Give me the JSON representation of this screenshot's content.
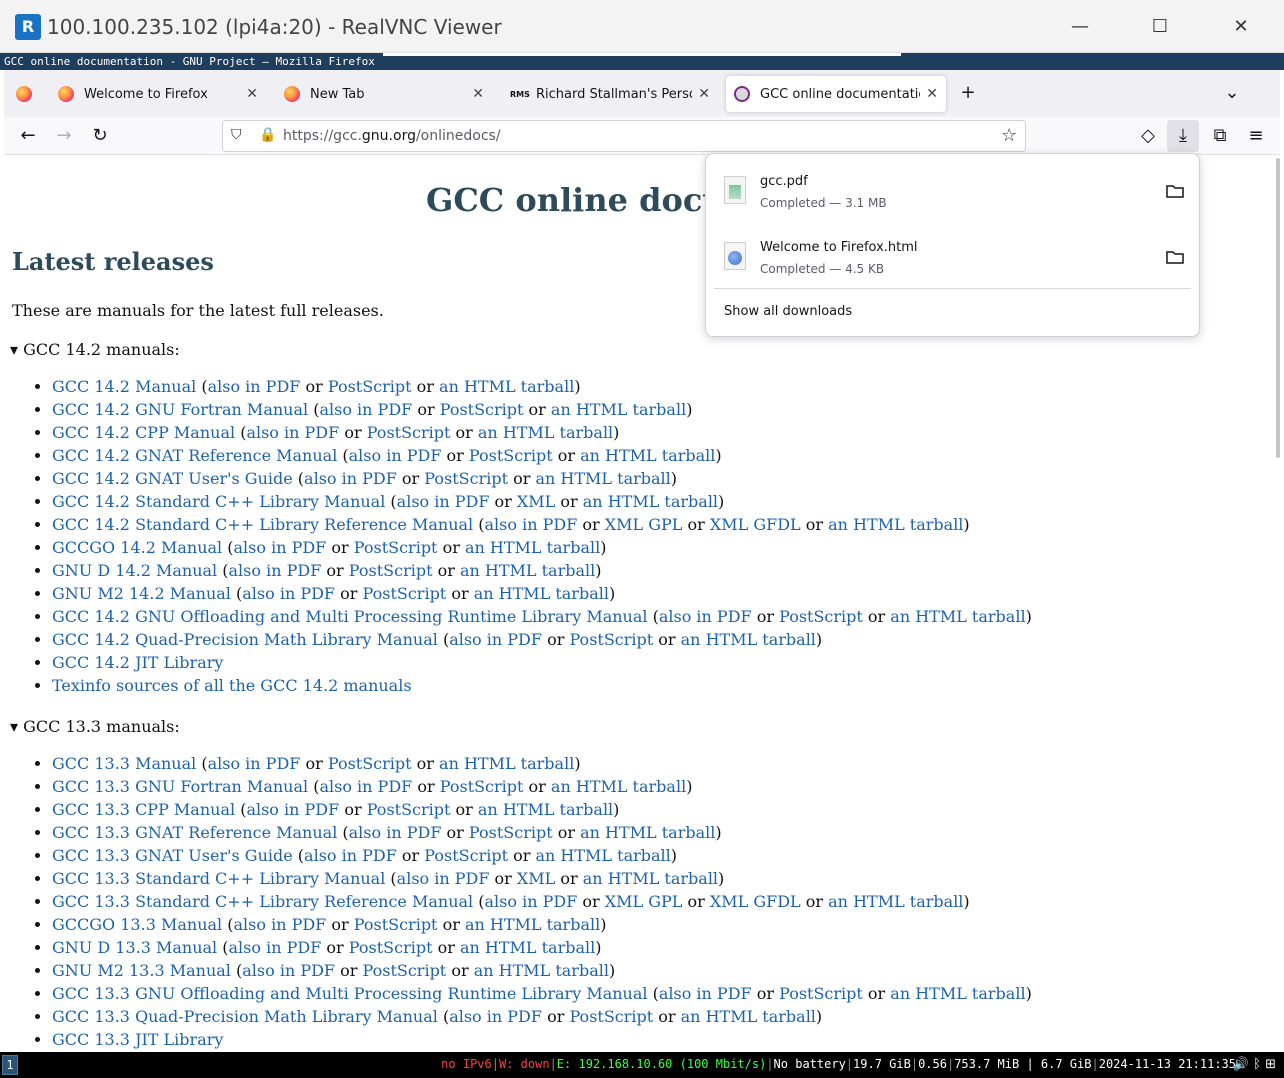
{
  "vnc": {
    "title": "100.100.235.102 (lpi4a:20) - RealVNC Viewer",
    "logo": "R",
    "minimize": "—",
    "maximize": "☐",
    "close": "✕"
  },
  "xwindow": {
    "title": "GCC online documentation - GNU Project — Mozilla Firefox"
  },
  "tabs": [
    {
      "label": "Welcome to Firefox",
      "icon": "firefox-icon"
    },
    {
      "label": "New Tab",
      "icon": "firefox-icon"
    },
    {
      "label": "Richard Stallman's Personal Site",
      "icon": "rms-icon",
      "icon_text": "RMS"
    },
    {
      "label": "GCC online documentation",
      "icon": "gnu-icon",
      "active": true
    }
  ],
  "toolbar": {
    "url_prefix": "https://gcc.",
    "url_domain": "gnu.org",
    "url_path": "/onlinedocs/",
    "new_tab": "+",
    "tab_list": "⌄",
    "back": "←",
    "forward": "→",
    "reload": "↻",
    "bookmark": "☆",
    "pocket": "◇",
    "downloads": "⤓",
    "extensions": "⧉",
    "menu": "≡"
  },
  "page": {
    "title": "GCC online documentation",
    "latest_heading": "Latest releases",
    "latest_intro": "These are manuals for the latest full releases.",
    "sections": [
      {
        "summary": "▾ GCC 14.2 manuals:",
        "items": [
          {
            "name": "GCC 14.2 Manual",
            "pdf": "also in PDF",
            "fmt": "PostScript",
            "tar": "an HTML tarball"
          },
          {
            "name": "GCC 14.2 GNU Fortran Manual",
            "pdf": "also in PDF",
            "fmt": "PostScript",
            "tar": "an HTML tarball"
          },
          {
            "name": "GCC 14.2 CPP Manual",
            "pdf": "also in PDF",
            "fmt": "PostScript",
            "tar": "an HTML tarball"
          },
          {
            "name": "GCC 14.2 GNAT Reference Manual",
            "pdf": "also in PDF",
            "fmt": "PostScript",
            "tar": "an HTML tarball"
          },
          {
            "name": "GCC 14.2 GNAT User's Guide",
            "pdf": "also in PDF",
            "fmt": "PostScript",
            "tar": "an HTML tarball"
          },
          {
            "name": "GCC 14.2 Standard C++ Library Manual",
            "pdf": "also in PDF",
            "fmt": "XML",
            "tar": "an HTML tarball"
          },
          {
            "name": "GCC 14.2 Standard C++ Library Reference Manual",
            "pdf": "also in PDF",
            "fmt": "XML GPL",
            "fmt2": "XML GFDL",
            "tar": "an HTML tarball"
          },
          {
            "name": "GCCGO 14.2 Manual",
            "pdf": "also in PDF",
            "fmt": "PostScript",
            "tar": "an HTML tarball"
          },
          {
            "name": "GNU D 14.2 Manual",
            "pdf": "also in PDF",
            "fmt": "PostScript",
            "tar": "an HTML tarball"
          },
          {
            "name": "GNU M2 14.2 Manual",
            "pdf": "also in PDF",
            "fmt": "PostScript",
            "tar": "an HTML tarball"
          },
          {
            "name": "GCC 14.2 GNU Offloading and Multi Processing Runtime Library Manual",
            "pdf": "also in PDF",
            "fmt": "PostScript",
            "tar": "an HTML tarball"
          },
          {
            "name": "GCC 14.2 Quad-Precision Math Library Manual",
            "pdf": "also in PDF",
            "fmt": "PostScript",
            "tar": "an HTML tarball"
          },
          {
            "name": "GCC 14.2 JIT Library"
          },
          {
            "name": "Texinfo sources of all the GCC 14.2 manuals"
          }
        ]
      },
      {
        "summary": "▾ GCC 13.3 manuals:",
        "items": [
          {
            "name": "GCC 13.3 Manual",
            "pdf": "also in PDF",
            "fmt": "PostScript",
            "tar": "an HTML tarball"
          },
          {
            "name": "GCC 13.3 GNU Fortran Manual",
            "pdf": "also in PDF",
            "fmt": "PostScript",
            "tar": "an HTML tarball"
          },
          {
            "name": "GCC 13.3 CPP Manual",
            "pdf": "also in PDF",
            "fmt": "PostScript",
            "tar": "an HTML tarball"
          },
          {
            "name": "GCC 13.3 GNAT Reference Manual",
            "pdf": "also in PDF",
            "fmt": "PostScript",
            "tar": "an HTML tarball"
          },
          {
            "name": "GCC 13.3 GNAT User's Guide",
            "pdf": "also in PDF",
            "fmt": "PostScript",
            "tar": "an HTML tarball"
          },
          {
            "name": "GCC 13.3 Standard C++ Library Manual",
            "pdf": "also in PDF",
            "fmt": "XML",
            "tar": "an HTML tarball"
          },
          {
            "name": "GCC 13.3 Standard C++ Library Reference Manual",
            "pdf": "also in PDF",
            "fmt": "XML GPL",
            "fmt2": "XML GFDL",
            "tar": "an HTML tarball"
          },
          {
            "name": "GCCGO 13.3 Manual",
            "pdf": "also in PDF",
            "fmt": "PostScript",
            "tar": "an HTML tarball"
          },
          {
            "name": "GNU D 13.3 Manual",
            "pdf": "also in PDF",
            "fmt": "PostScript",
            "tar": "an HTML tarball"
          },
          {
            "name": "GNU M2 13.3 Manual",
            "pdf": "also in PDF",
            "fmt": "PostScript",
            "tar": "an HTML tarball"
          },
          {
            "name": "GCC 13.3 GNU Offloading and Multi Processing Runtime Library Manual",
            "pdf": "also in PDF",
            "fmt": "PostScript",
            "tar": "an HTML tarball"
          },
          {
            "name": "GCC 13.3 Quad-Precision Math Library Manual",
            "pdf": "also in PDF",
            "fmt": "PostScript",
            "tar": "an HTML tarball"
          },
          {
            "name": "GCC 13.3 JIT Library"
          }
        ]
      }
    ]
  },
  "downloads": {
    "items": [
      {
        "name": "gcc.pdf",
        "status": "Completed — 3.1 MB"
      },
      {
        "name": "Welcome to Firefox.html",
        "status": "Completed — 4.5 KB"
      }
    ],
    "show_all": "Show all downloads"
  },
  "statusbar": {
    "workspace": "1",
    "ipv6": "no IPv6",
    "wireless": "W: down",
    "ethernet": "E: 192.168.10.60 (100 Mbit/s)",
    "battery": "No battery",
    "disk": "19.7 GiB",
    "load": "0.56",
    "memory": "753.7 MiB | 6.7 GiB",
    "datetime": "2024-11-13 21:11:35",
    "tray": "🔊 ᛒ ⊞"
  },
  "colors": {
    "link": "#1e62a8",
    "heading": "#2d4b5a",
    "x_titlebar": "#1f3d5c",
    "status_bad": "#ff4040",
    "status_good": "#40ff40"
  }
}
